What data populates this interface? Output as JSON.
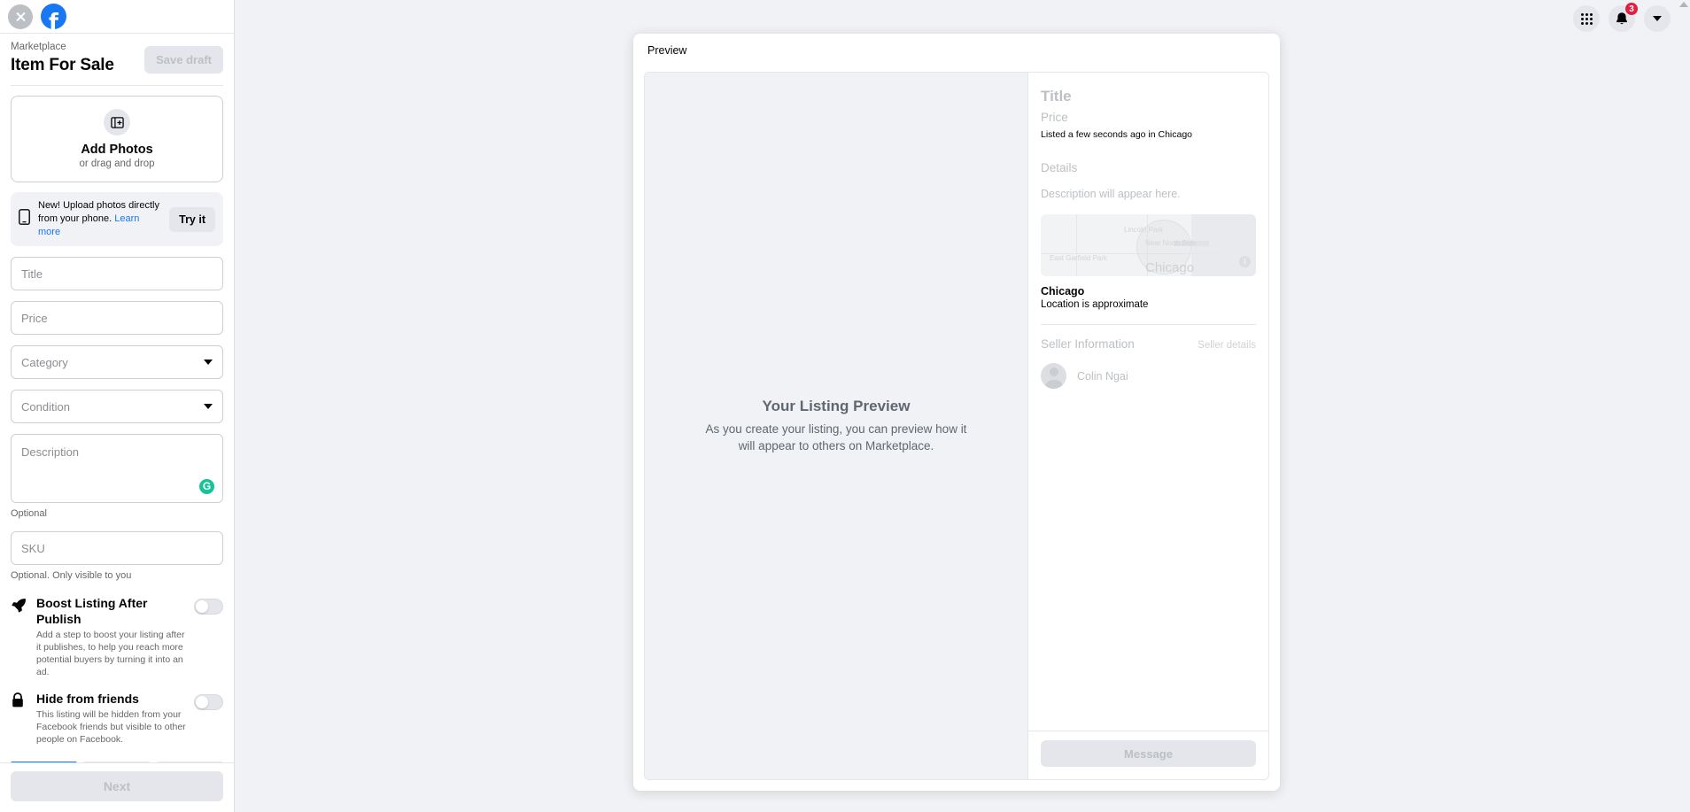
{
  "window": {
    "background_color": "#f0f2f5",
    "accent_color": "#1877f2"
  },
  "sidebar": {
    "close_icon": "close-icon",
    "logo_letter": "f",
    "kicker": "Marketplace",
    "title": "Item For Sale",
    "save_draft_label": "Save draft",
    "photo_box": {
      "icon": "add-photo-icon",
      "title": "Add Photos",
      "subtitle": "or drag and drop"
    },
    "banner": {
      "icon": "phone-icon",
      "text_before": "New! Upload photos directly from your phone.",
      "link": "Learn more",
      "button": "Try it"
    },
    "fields": [
      {
        "name": "title",
        "placeholder": "Title",
        "value": "",
        "type": "text"
      },
      {
        "name": "price",
        "placeholder": "Price",
        "value": "",
        "type": "text"
      },
      {
        "name": "category",
        "placeholder": "Category",
        "value": "",
        "type": "select"
      },
      {
        "name": "condition",
        "placeholder": "Condition",
        "value": "",
        "type": "select"
      }
    ],
    "description": {
      "placeholder": "Description",
      "value": "",
      "helper": "Optional",
      "grammarly_icon_letter": "G",
      "grammarly_color": "#15c39a"
    },
    "sku": {
      "placeholder": "SKU",
      "value": "",
      "helper": "Optional. Only visible to you"
    },
    "toggles": [
      {
        "icon": "rocket-icon",
        "title": "Boost Listing After Publish",
        "description": "Add a step to boost your listing after it publishes, to help you reach more potential buyers by turning it into an ad.",
        "state": "off"
      },
      {
        "icon": "lock-icon",
        "title": "Hide from friends",
        "description": "This listing will be hidden from your Facebook friends but visible to other people on Facebook.",
        "state": "off"
      }
    ],
    "progress": {
      "total_steps": 3,
      "current_step": 1
    },
    "next_label": "Next"
  },
  "header": {
    "apps_icon": "grid-apps-icon",
    "notifications_icon": "bell-icon",
    "notifications_count": "3",
    "notifications_badge_color": "#e41e3f",
    "account_icon": "chevron-down-icon"
  },
  "preview": {
    "label": "Preview",
    "empty_state": {
      "title": "Your Listing Preview",
      "subtitle": "As you create your listing, you can preview how it will appear to others on Marketplace."
    },
    "details": {
      "title": "Title",
      "price": "Price",
      "listed": "Listed a few seconds ago in Chicago",
      "details_heading": "Details",
      "description_placeholder": "Description will appear here."
    },
    "map": {
      "labels": [
        "Lincoln Park",
        "Near North Side",
        "East Garfield Park",
        "Chicago"
      ],
      "info_icon": "info-icon",
      "city": "Chicago",
      "approximate_note": "Location is approximate"
    },
    "seller": {
      "heading": "Seller Information",
      "details_link": "Seller details",
      "avatar": "avatar",
      "name": "Colin Ngai"
    },
    "message_label": "Message"
  }
}
